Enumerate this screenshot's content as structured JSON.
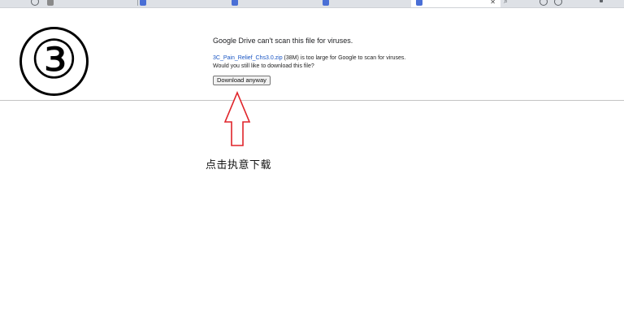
{
  "tabs": [
    {
      "label": "",
      "active": false
    },
    {
      "label": "",
      "active": false
    },
    {
      "label": "",
      "active": false
    },
    {
      "label": "",
      "active": false
    },
    {
      "label": "",
      "active": true
    }
  ],
  "step": {
    "number": "③"
  },
  "warning": {
    "title": "Google Drive can't scan this file for viruses.",
    "file_name": "3C_Pain_Relief_Chs3.0.zip",
    "size_message": " (38M) is too large for Google to scan for viruses.",
    "question": "Would you still like to download this file?",
    "download_label": "Download anyway"
  },
  "annotation": {
    "text": "点击执意下载",
    "arrow_color": "#e0242a"
  }
}
